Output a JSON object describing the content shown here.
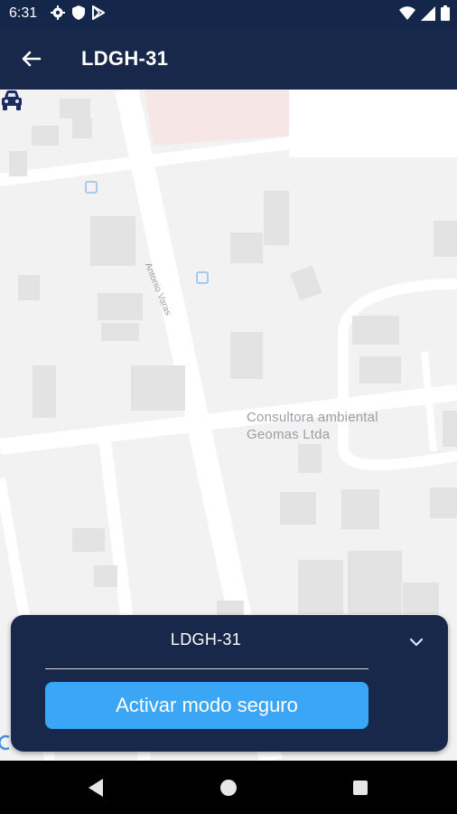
{
  "status_bar": {
    "time": "6:31",
    "left_icons": [
      "settings-gear-icon",
      "shield-icon",
      "play-store-icon"
    ],
    "right_icons": [
      "wifi-icon",
      "signal-icon",
      "battery-icon"
    ]
  },
  "app_bar": {
    "back_icon": "arrow-left-icon",
    "title": "LDGH-31"
  },
  "map": {
    "street_label": "Antonio Varas",
    "poi_label_line1": "Consultora ambiental",
    "poi_label_line2": "Geomas Ltda",
    "marker_icon": "car-icon"
  },
  "vehicle_card": {
    "title": "LDGH-31",
    "expand_icon": "chevron-down-icon",
    "button_label": "Activar modo seguro"
  },
  "colors": {
    "app_bar": "#17284a",
    "accent_button": "#3aa6f5",
    "marker": "#1c2a5e"
  }
}
